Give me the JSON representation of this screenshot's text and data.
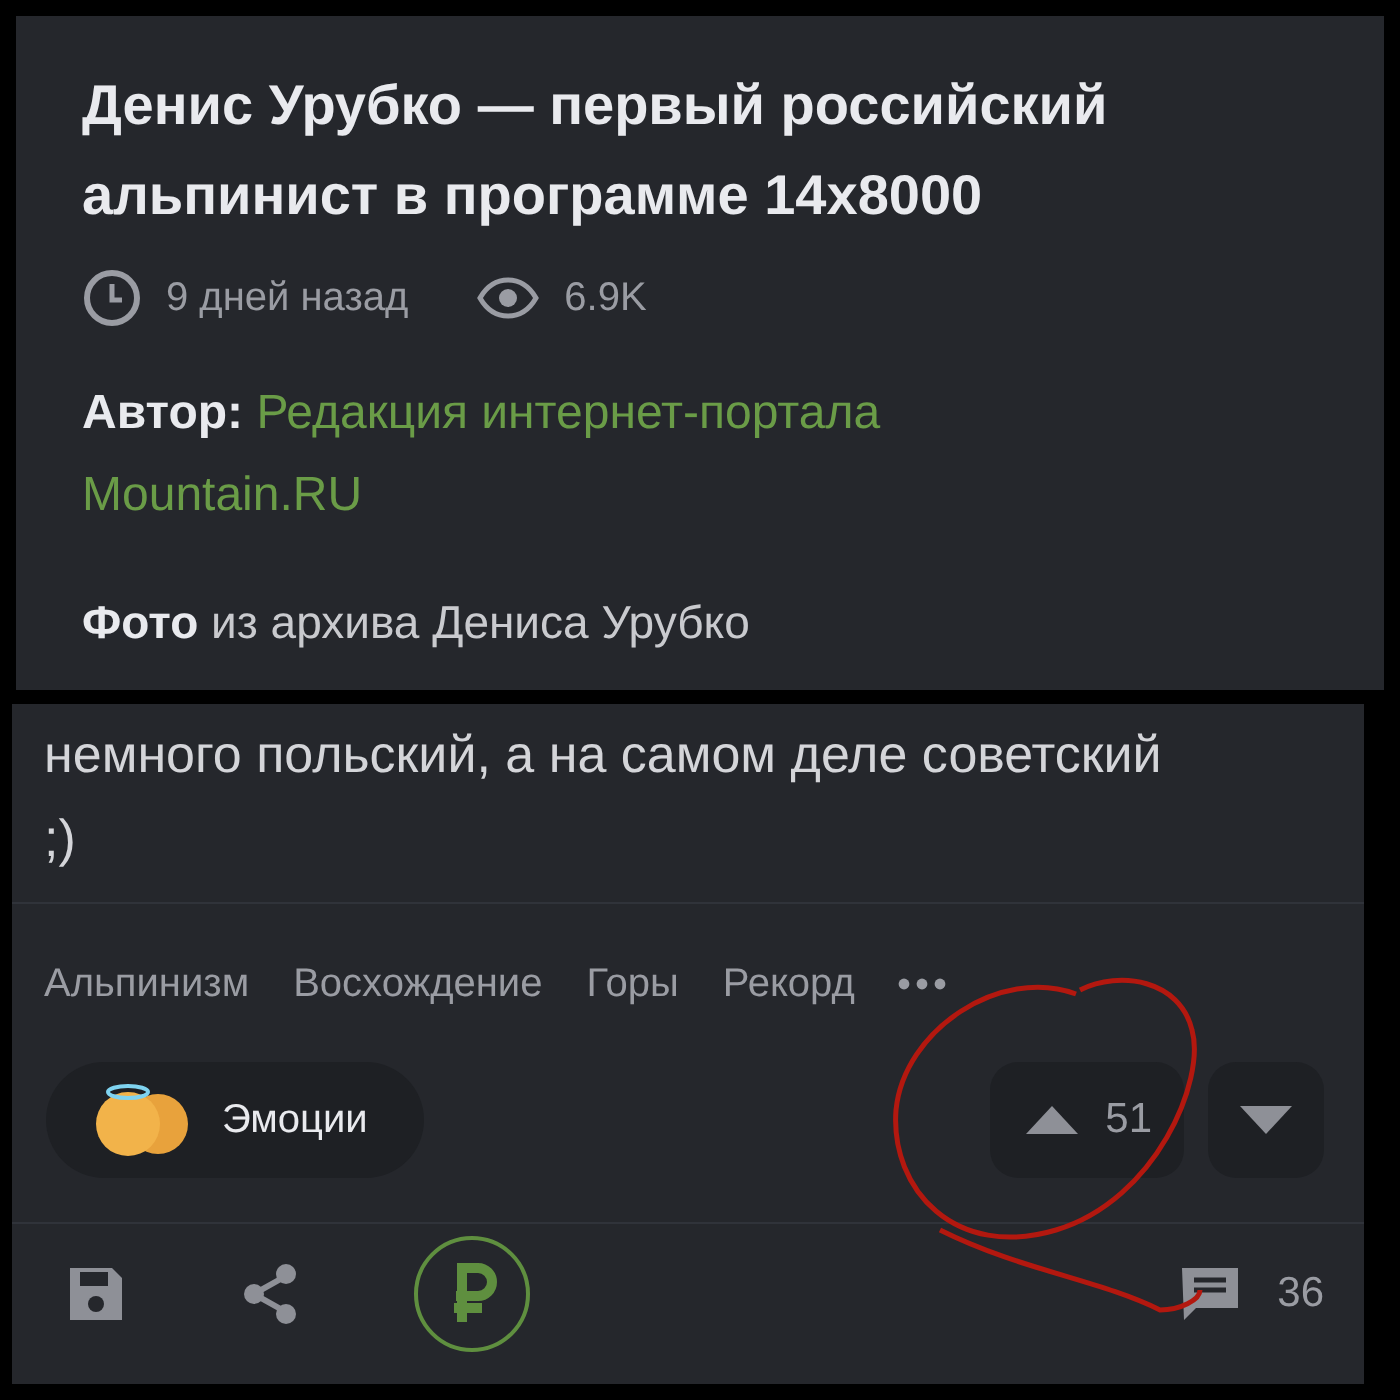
{
  "article": {
    "title": "Денис Урубко — первый российский альпинист в программе 14x8000",
    "date": "9 дней назад",
    "views": "6.9K",
    "author_label": "Автор:",
    "author": "Редакция интернет-портала Mountain.RU",
    "photo_credit": "**Фото** из архива Дениса Урубко"
  },
  "comment": {
    "text": "немного польский, а на самом деле советский ;)",
    "tags": [
      {
        "label": "Альпинизм"
      },
      {
        "label": "Восхождение"
      },
      {
        "label": "Горы"
      },
      {
        "label": "Рекорд"
      }
    ],
    "emotions_label": "Эмоции",
    "upvotes": "51",
    "comments_count": "36"
  }
}
